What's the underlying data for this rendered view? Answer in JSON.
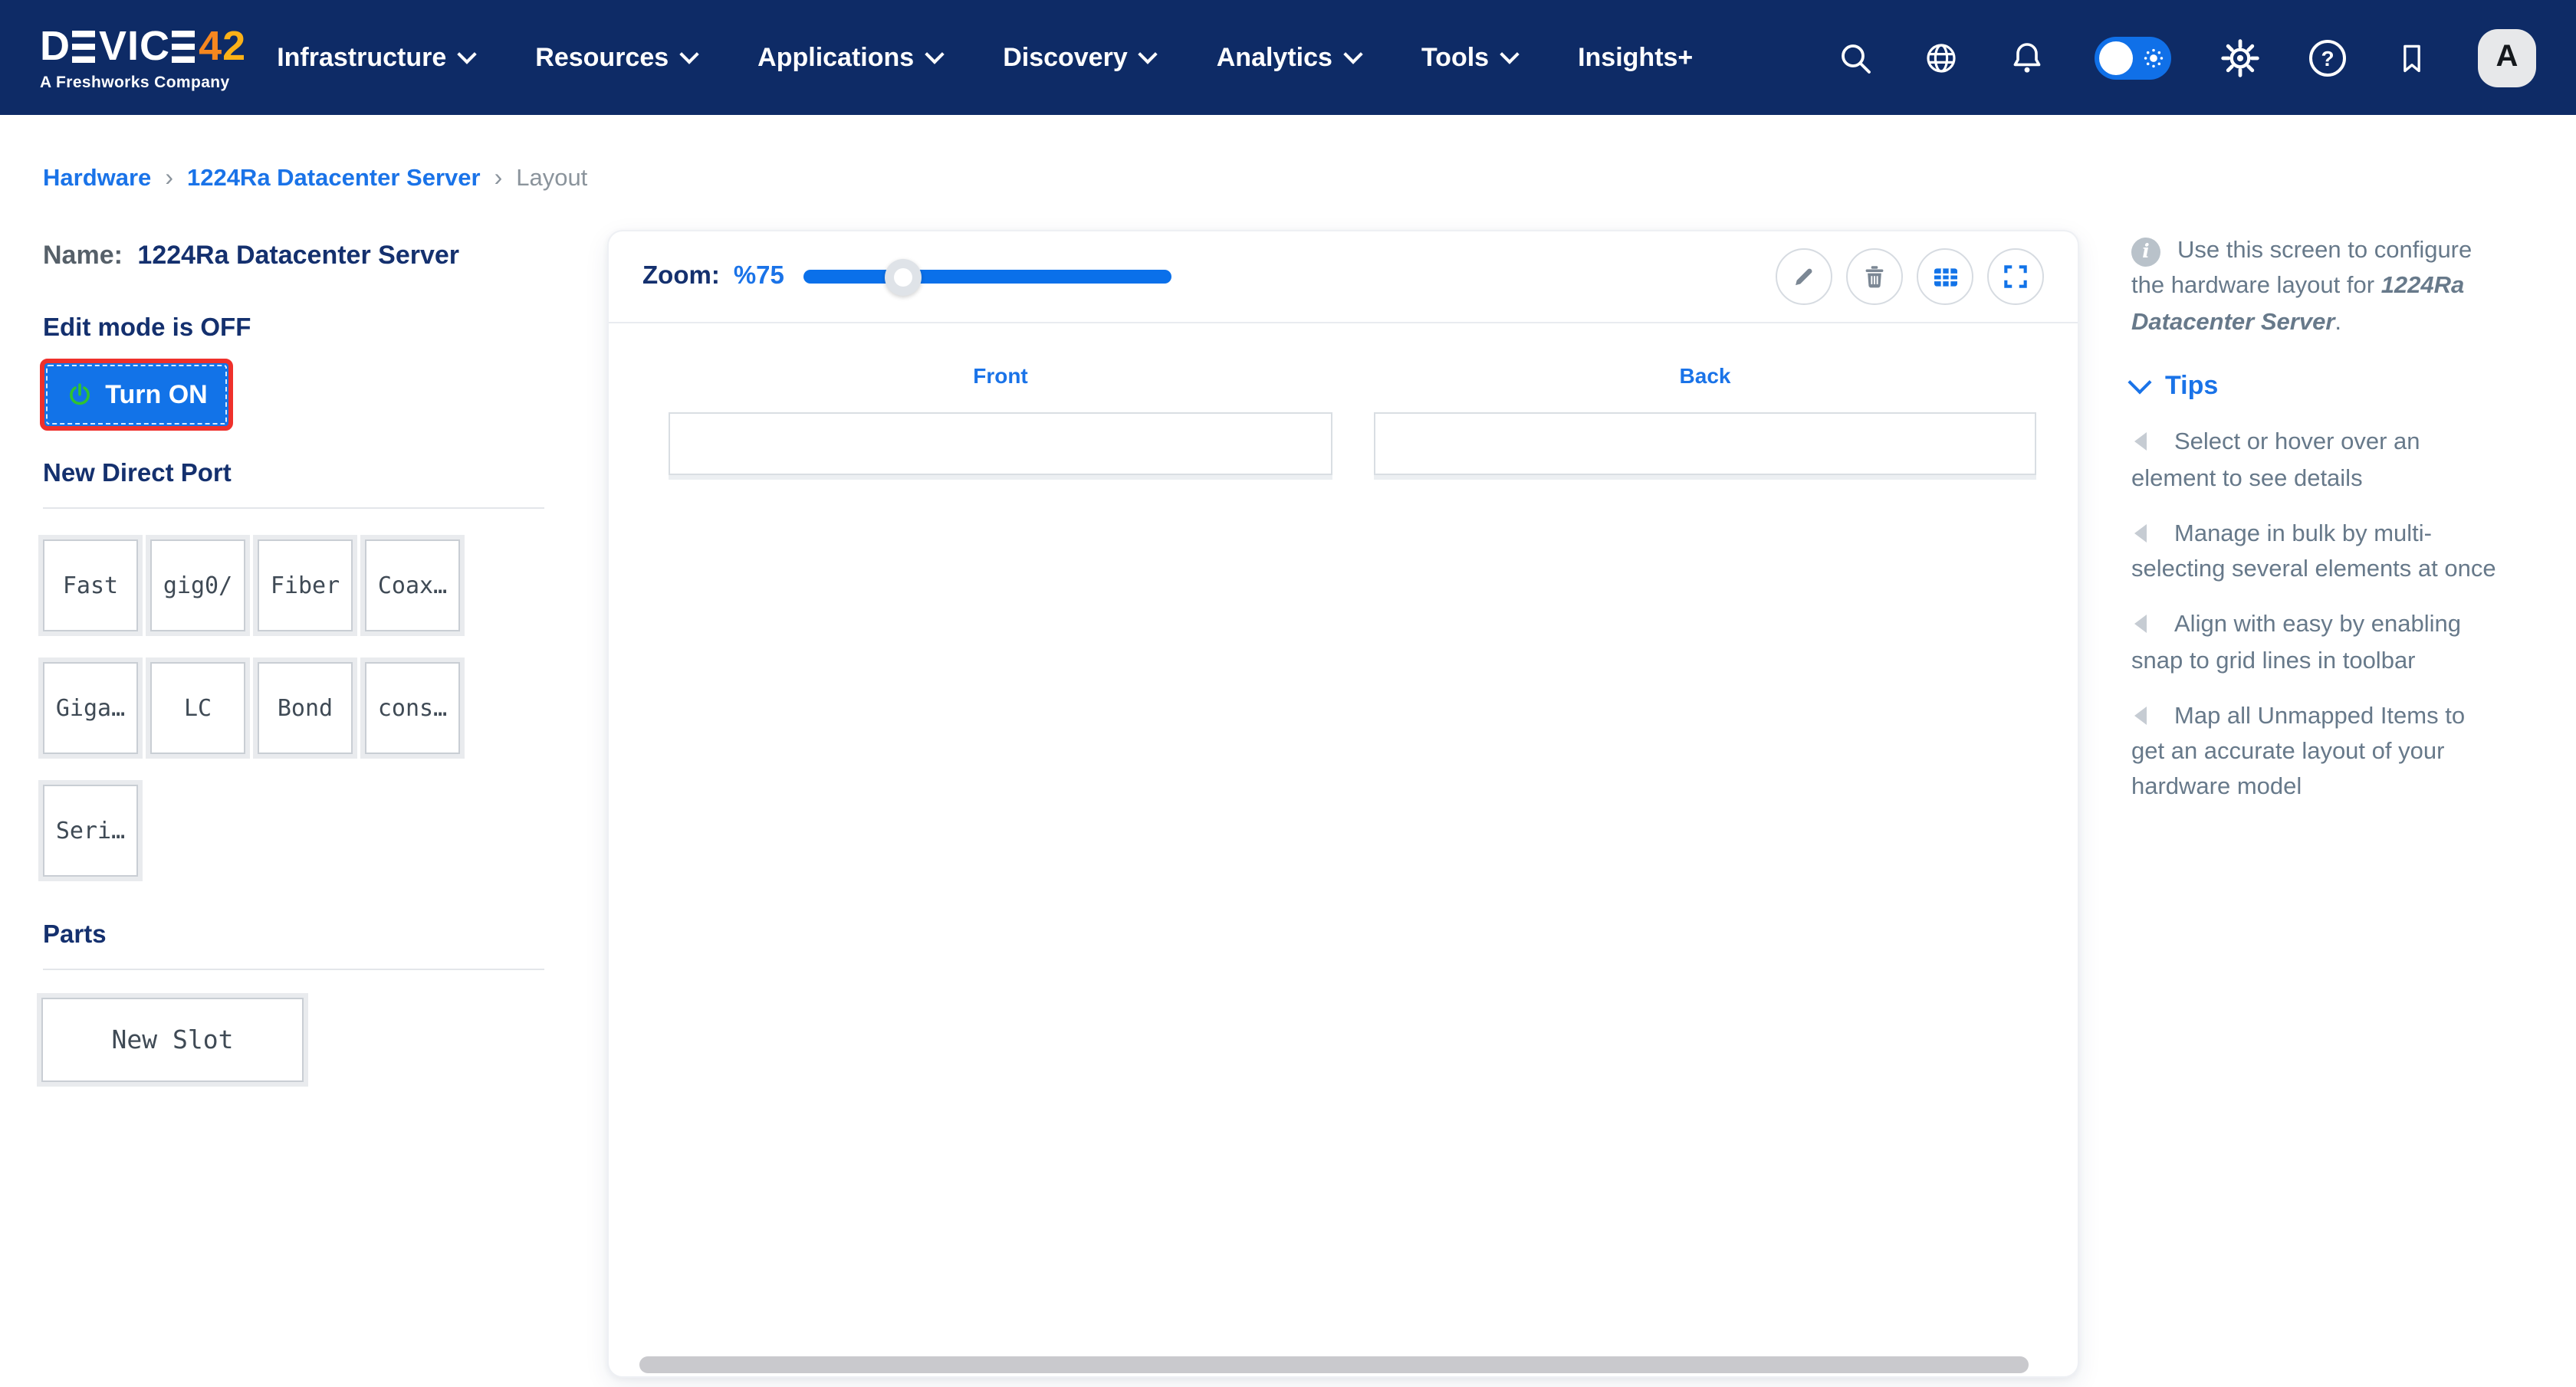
{
  "colors": {
    "navbar_bg": "#0e2b66",
    "accent_blue": "#1a73e8",
    "slider_blue": "#0a70ea",
    "button_blue": "#1273e8",
    "button_border_red": "#ef302b",
    "power_green": "#2fc32f",
    "heading_navy": "#14306e",
    "text_slate": "#67798a",
    "logo_orange": "#f6871f",
    "logo_amber": "#fbb117"
  },
  "icons": {
    "help_glyph": "?",
    "info_glyph": "i"
  },
  "navbar": {
    "logo": {
      "p1": "D",
      "e1": "E",
      "p2": "VIC",
      "e2": "E",
      "n4": "4",
      "n2": "2",
      "subtitle": "A Freshworks Company"
    },
    "menu": [
      {
        "label": "Infrastructure",
        "caret": true
      },
      {
        "label": "Resources",
        "caret": true
      },
      {
        "label": "Applications",
        "caret": true
      },
      {
        "label": "Discovery",
        "caret": true
      },
      {
        "label": "Analytics",
        "caret": true
      },
      {
        "label": "Tools",
        "caret": true
      },
      {
        "label": "Insights+",
        "caret": false
      }
    ],
    "avatar_letter": "A"
  },
  "breadcrumb": {
    "separator": "›",
    "items": [
      {
        "label": "Hardware"
      },
      {
        "label": "1224Ra Datacenter Server"
      },
      {
        "label": "Layout"
      }
    ]
  },
  "left_panel": {
    "name_label": "Name:",
    "name_value": "1224Ra Datacenter Server",
    "edit_mode_text": "Edit mode is OFF",
    "turn_on_label": "Turn ON",
    "new_direct_port_title": "New Direct Port",
    "ports": [
      "Fast",
      "gig0/",
      "Fiber",
      "Coax…",
      "Giga…",
      "LC",
      "Bond",
      "cons…",
      "Seri…"
    ],
    "parts_title": "Parts",
    "new_slot_label": "New Slot"
  },
  "canvas": {
    "zoom_label": "Zoom:",
    "zoom_value": "%75",
    "zoom_percent": 75,
    "slider_position_pct": 27,
    "front_label": "Front",
    "back_label": "Back"
  },
  "tips_panel": {
    "info_prefix": "Use this screen to configure\nthe hardware layout for ",
    "info_name": "1224Ra\nDatacenter Server",
    "info_suffix": ".",
    "title": "Tips",
    "tips": [
      "Select or hover over an\nelement to see details",
      "Manage in bulk by multi-\nselecting several elements at once",
      "Align with easy by enabling\nsnap to grid lines in toolbar",
      "Map all Unmapped Items to\nget an accurate layout of your\nhardware model"
    ]
  }
}
